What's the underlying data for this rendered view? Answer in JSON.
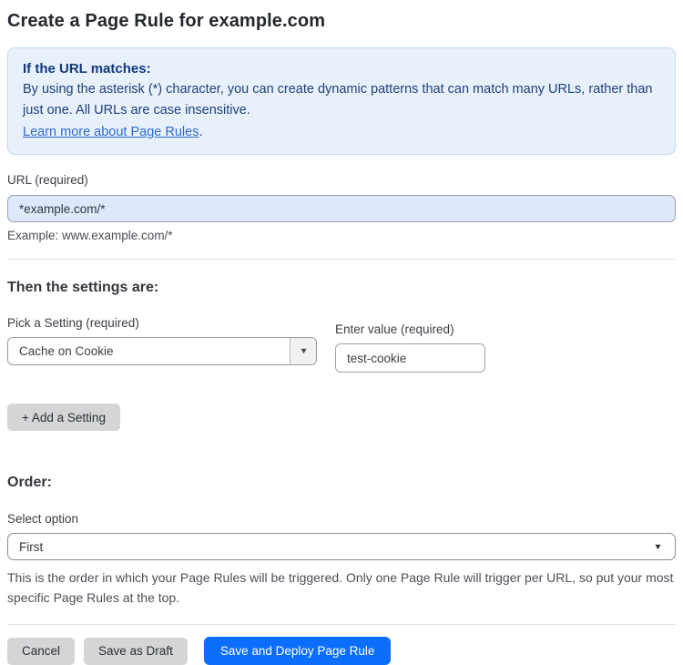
{
  "page": {
    "title": "Create a Page Rule for example.com"
  },
  "info_box": {
    "heading": "If the URL matches:",
    "body": "By using the asterisk (*) character, you can create dynamic patterns that can match many URLs, rather than just one. All URLs are case insensitive.",
    "link_label": "Learn more about Page Rules",
    "link_suffix": "."
  },
  "url_field": {
    "label": "URL (required)",
    "value": "*example.com/*",
    "example": "Example: www.example.com/*"
  },
  "settings_section": {
    "heading": "Then the settings are:",
    "setting_label": "Pick a Setting (required)",
    "setting_value": "Cache on Cookie",
    "value_label": "Enter value (required)",
    "value_value": "test-cookie",
    "add_button_label": "+ Add a Setting"
  },
  "order_section": {
    "heading": "Order:",
    "select_label": "Select option",
    "select_value": "First",
    "help_text": "This is the order in which your Page Rules will be triggered. Only one Page Rule will trigger per URL, so put your most specific Page Rules at the top."
  },
  "footer": {
    "cancel_label": "Cancel",
    "save_draft_label": "Save as Draft",
    "save_deploy_label": "Save and Deploy Page Rule"
  },
  "icons": {
    "dropdown_caret": "▼"
  },
  "colors": {
    "info_box_bg": "#e8f1fb",
    "info_box_border": "#bfd9f4",
    "info_text": "#1e4178",
    "info_heading": "#14397c",
    "link_blue": "#2d6bcf",
    "url_input_bg": "#dde9fb",
    "primary_button_bg": "#0d6efd",
    "secondary_button_bg": "#d4d5d6"
  }
}
